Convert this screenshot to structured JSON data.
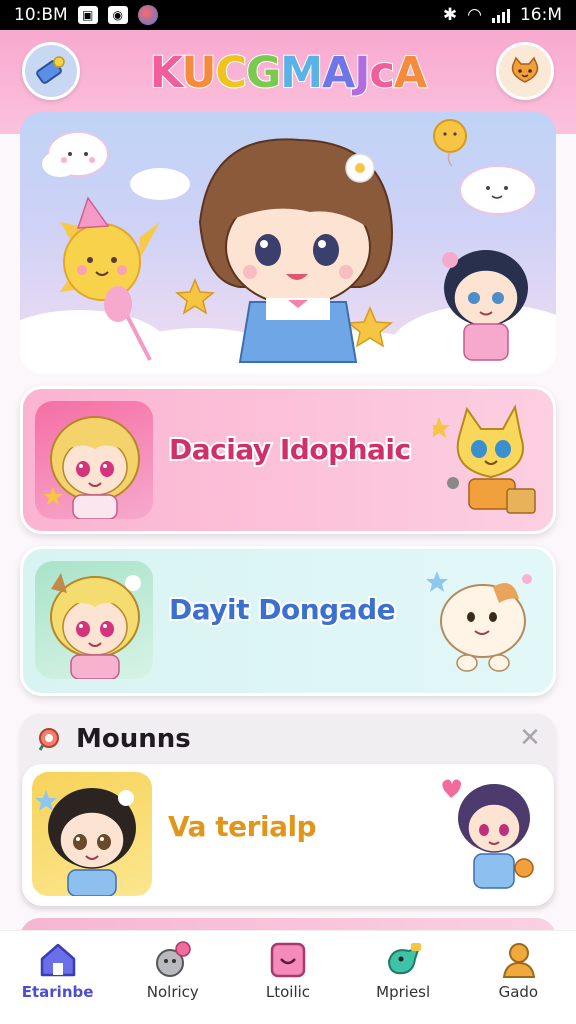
{
  "status_bar": {
    "time_left": "10:BM",
    "time_right": "16:M"
  },
  "header": {
    "logo_letters": [
      "K",
      "U",
      "C",
      "G",
      "M",
      "A",
      "J",
      "c",
      "A"
    ],
    "logo_colors": [
      "#f25d9c",
      "#f58b3c",
      "#f0c31f",
      "#7bc950",
      "#5ab3e6",
      "#6f77e8",
      "#b06de0",
      "#f25d9c",
      "#f58b3c"
    ],
    "left_button_icon": "ticket-icon",
    "right_button_icon": "cat-icon"
  },
  "hero": {
    "icons": [
      "cloud-icon",
      "sun-icon",
      "star-icon",
      "balloon-icon",
      "candy-icon"
    ]
  },
  "cards": [
    {
      "title": "Daciay Idophaic",
      "accent": "#d12f6c"
    },
    {
      "title": "Dayit Dongade",
      "accent": "#3b6fd0"
    }
  ],
  "section": {
    "title": "Mounns",
    "close_glyph": "✕",
    "item": {
      "title": "Va terialp",
      "accent": "#e0961b"
    }
  },
  "bottom_nav": [
    {
      "label": "Etarinbe",
      "icon": "home-icon",
      "active": true
    },
    {
      "label": "Nolricy",
      "icon": "game-icon",
      "active": false
    },
    {
      "label": "Ltoilic",
      "icon": "chat-icon",
      "active": false
    },
    {
      "label": "Mpriesl",
      "icon": "bird-icon",
      "active": false
    },
    {
      "label": "Gado",
      "icon": "profile-icon",
      "active": false
    }
  ],
  "colors": {
    "header_pink": "#f8a9cf",
    "nav_active": "#4b4ed2"
  }
}
